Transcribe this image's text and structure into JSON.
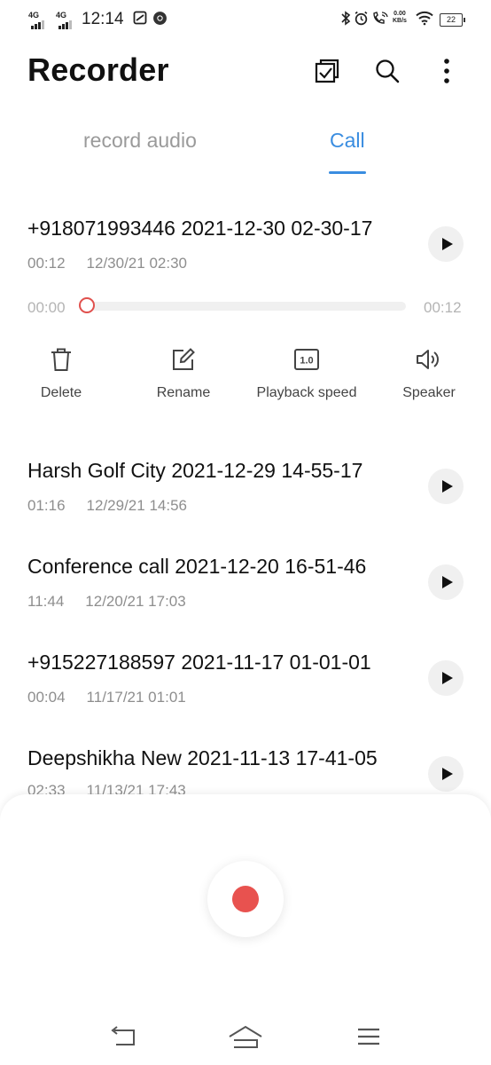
{
  "status_bar": {
    "network_1": "4G",
    "network_2": "4G",
    "time": "12:14",
    "net_speed_value": "0.00",
    "net_speed_unit": "KB/s",
    "battery": "22"
  },
  "header": {
    "title": "Recorder",
    "icons": [
      "checkbox-select-icon",
      "search-icon",
      "more-vert-icon"
    ]
  },
  "tabs": [
    {
      "label": "record audio",
      "selected": false
    },
    {
      "label": "Call",
      "selected": true
    }
  ],
  "expanded": {
    "title": "+918071993446 2021-12-30 02-30-17",
    "duration": "00:12",
    "date": "12/30/21 02:30",
    "position": "00:00",
    "total": "00:12",
    "progress": 0,
    "actions": [
      {
        "label": "Delete",
        "icon": "trash-icon"
      },
      {
        "label": "Rename",
        "icon": "edit-icon"
      },
      {
        "label": "Playback speed",
        "icon": "speed-icon",
        "icon_text": "1.0"
      },
      {
        "label": "Speaker",
        "icon": "speaker-icon"
      }
    ]
  },
  "recordings": [
    {
      "title": "Harsh Golf City 2021-12-29 14-55-17",
      "duration": "01:16",
      "date": "12/29/21 14:56"
    },
    {
      "title": "Conference call 2021-12-20 16-51-46",
      "duration": "11:44",
      "date": "12/20/21 17:03"
    },
    {
      "title": "+915227188597 2021-11-17 01-01-01",
      "duration": "00:04",
      "date": "11/17/21 01:01"
    },
    {
      "title": "Deepshikha New 2021-11-13 17-41-05",
      "duration": "02:33",
      "date": "11/13/21 17:43"
    }
  ],
  "colors": {
    "accent": "#3a8de0",
    "record": "#e8524f"
  }
}
